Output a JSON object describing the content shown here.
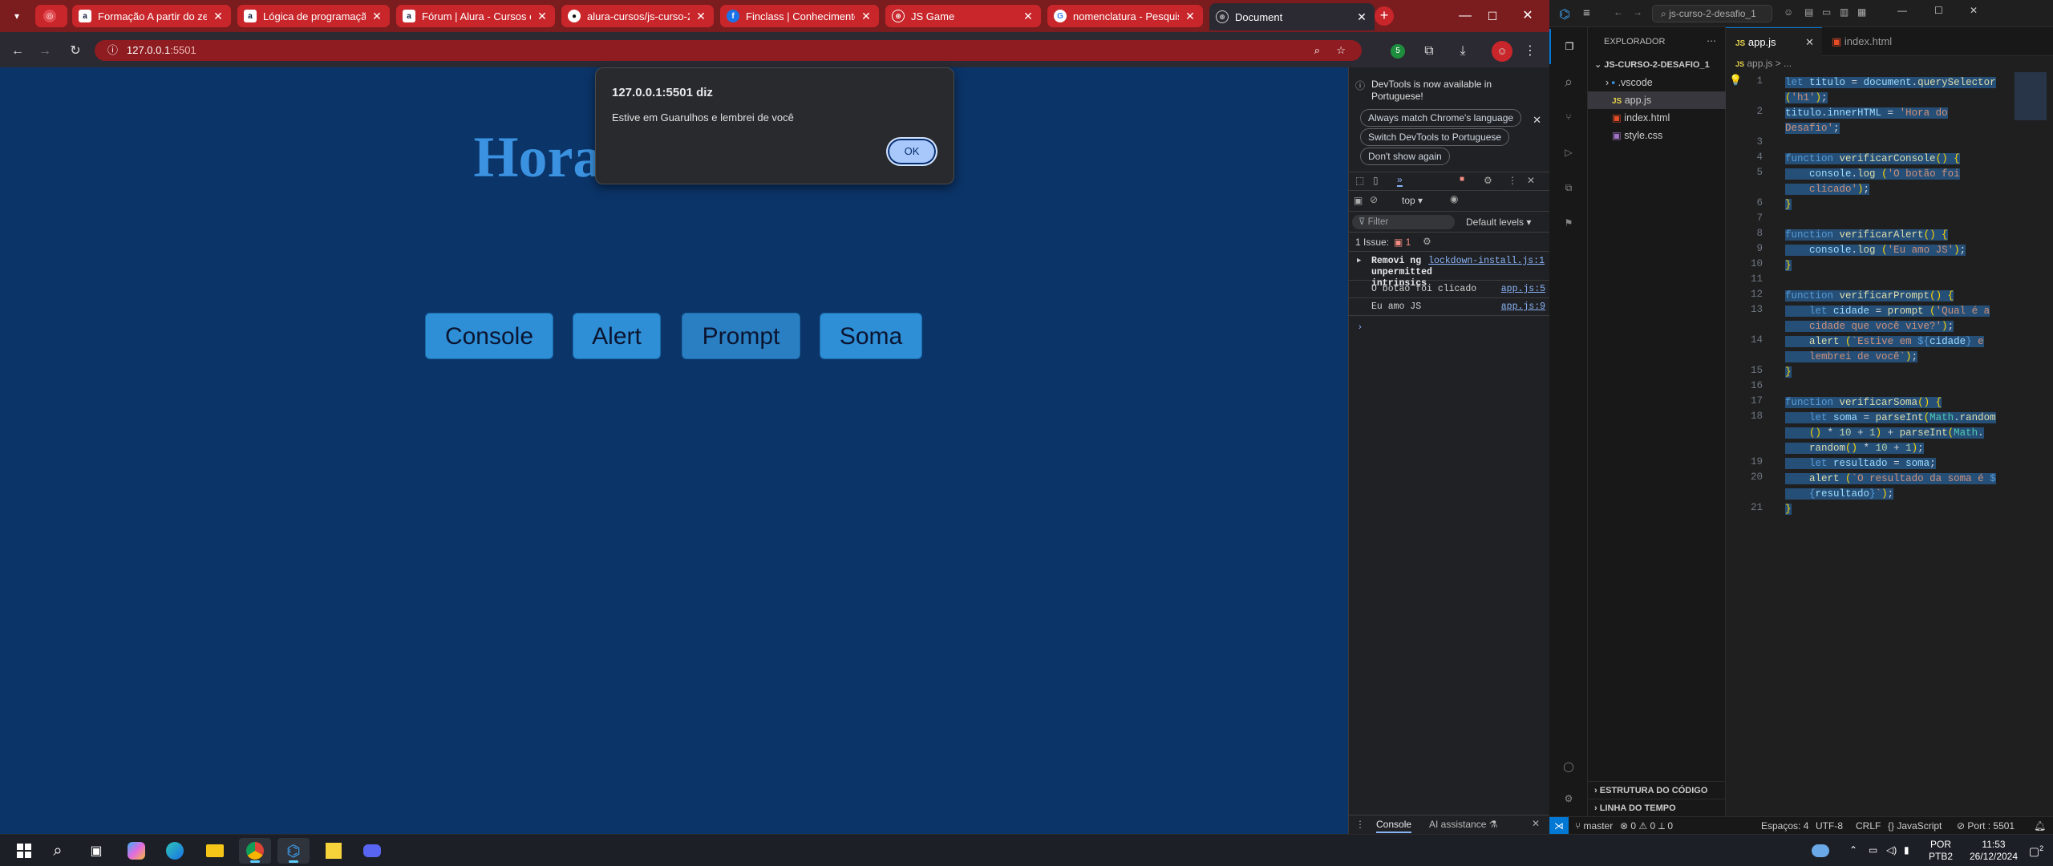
{
  "chrome": {
    "tabs": [
      {
        "title": "Formação A partir do ze",
        "icon": "alura-icon"
      },
      {
        "title": "Lógica de programação",
        "icon": "alura-icon"
      },
      {
        "title": "Fórum | Alura - Cursos o",
        "icon": "alura-icon"
      },
      {
        "title": "alura-cursos/js-curso-2",
        "icon": "github-icon"
      },
      {
        "title": "Finclass | Conhecimento",
        "icon": "finclass-icon"
      },
      {
        "title": "JS Game",
        "icon": "globe-icon"
      },
      {
        "title": "nomenclatura - Pesquisa",
        "icon": "google-icon"
      },
      {
        "title": "Document",
        "icon": "globe-icon"
      }
    ],
    "url_host": "127.0.0.1",
    "url_port": ":5501"
  },
  "page": {
    "heading": "Hora do Desafio",
    "buttons": [
      "Console",
      "Alert",
      "Prompt",
      "Soma"
    ]
  },
  "alert": {
    "title": "127.0.0.1:5501 diz",
    "message": "Estive em Guarulhos e lembrei de você",
    "ok": "OK"
  },
  "devtools": {
    "banner": "DevTools is now available in Portuguese!",
    "chips": [
      "Always match Chrome's language",
      "Switch DevTools to Portuguese",
      "Don't show again"
    ],
    "context": "top",
    "filter_placeholder": "Filter",
    "levels": "Default levels",
    "issues_label": "1 Issue:",
    "issues_count": "1",
    "messages": [
      {
        "text": "Removi ng unpermitted intrinsics",
        "source": "lockdown-install.js:1"
      },
      {
        "text": "O botão foi clicado",
        "source": "app.js:5"
      },
      {
        "text": "Eu amo JS",
        "source": "app.js:9"
      }
    ],
    "drawer_tabs": [
      "Console",
      "AI assistance"
    ]
  },
  "vscode": {
    "search": "js-curso-2-desafio_1",
    "explorer_title": "EXPLORADOR",
    "project": "JS-CURSO-2-DESAFIO_1",
    "files": [
      ".vscode",
      "app.js",
      "index.html",
      "style.css"
    ],
    "outline": "ESTRUTURA DO CÓDIGO",
    "timeline": "LINHA DO TEMPO",
    "tabs": [
      "app.js",
      "index.html"
    ],
    "breadcrumb": "app.js > ...",
    "status": {
      "branch": "master",
      "errors": "0",
      "warnings": "0",
      "ports": "0",
      "spaces": "Espaços: 4",
      "encoding": "UTF-8",
      "eol": "CRLF",
      "language": "JavaScript",
      "port": "Port : 5501"
    }
  },
  "taskbar": {
    "lang": "POR",
    "layout": "PTB2",
    "time": "11:53",
    "date": "26/12/2024",
    "notification_count": "2"
  },
  "colors": {
    "page_bg": "#0b3468",
    "heading": "#3a92e0",
    "button": "#2e8fd7",
    "tab_red": "#c8262b"
  }
}
